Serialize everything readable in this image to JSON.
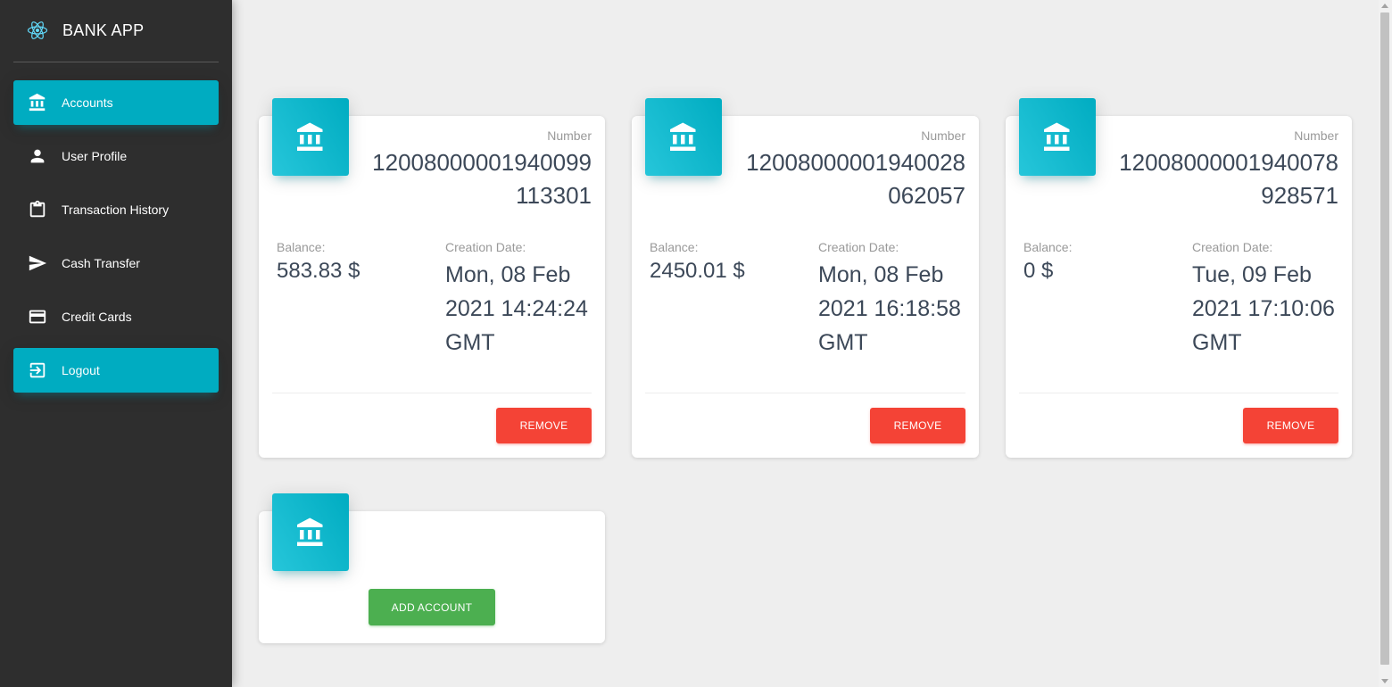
{
  "app": {
    "title": "BANK APP",
    "logo_icon": "react-atom-icon"
  },
  "sidebar": {
    "items": [
      {
        "label": "Accounts",
        "icon": "bank-icon",
        "active": true
      },
      {
        "label": "User Profile",
        "icon": "person-icon",
        "active": false
      },
      {
        "label": "Transaction History",
        "icon": "clipboard-icon",
        "active": false
      },
      {
        "label": "Cash Transfer",
        "icon": "send-icon",
        "active": false
      },
      {
        "label": "Credit Cards",
        "icon": "credit-card-icon",
        "active": false
      },
      {
        "label": "Logout",
        "icon": "logout-icon",
        "active": true
      }
    ]
  },
  "accounts": [
    {
      "number_label": "Number",
      "number": "12008000001940099113301",
      "balance_label": "Balance:",
      "balance": "583.83 $",
      "date_label": "Creation Date:",
      "date": "Mon, 08 Feb 2021 14:24:24 GMT",
      "remove_label": "REMOVE"
    },
    {
      "number_label": "Number",
      "number": "12008000001940028062057",
      "balance_label": "Balance:",
      "balance": "2450.01 $",
      "date_label": "Creation Date:",
      "date": "Mon, 08 Feb 2021 16:18:58 GMT",
      "remove_label": "REMOVE"
    },
    {
      "number_label": "Number",
      "number": "12008000001940078928571",
      "balance_label": "Balance:",
      "balance": "0 $",
      "date_label": "Creation Date:",
      "date": "Tue, 09 Feb 2021 17:10:06 GMT",
      "remove_label": "REMOVE"
    }
  ],
  "add_account": {
    "button_label": "ADD ACCOUNT",
    "icon": "bank-icon"
  },
  "colors": {
    "sidebar_bg": "#2e2e2e",
    "accent": "#00acc1",
    "danger": "#f44336",
    "success": "#4caf50",
    "page_bg": "#eeeeee"
  }
}
